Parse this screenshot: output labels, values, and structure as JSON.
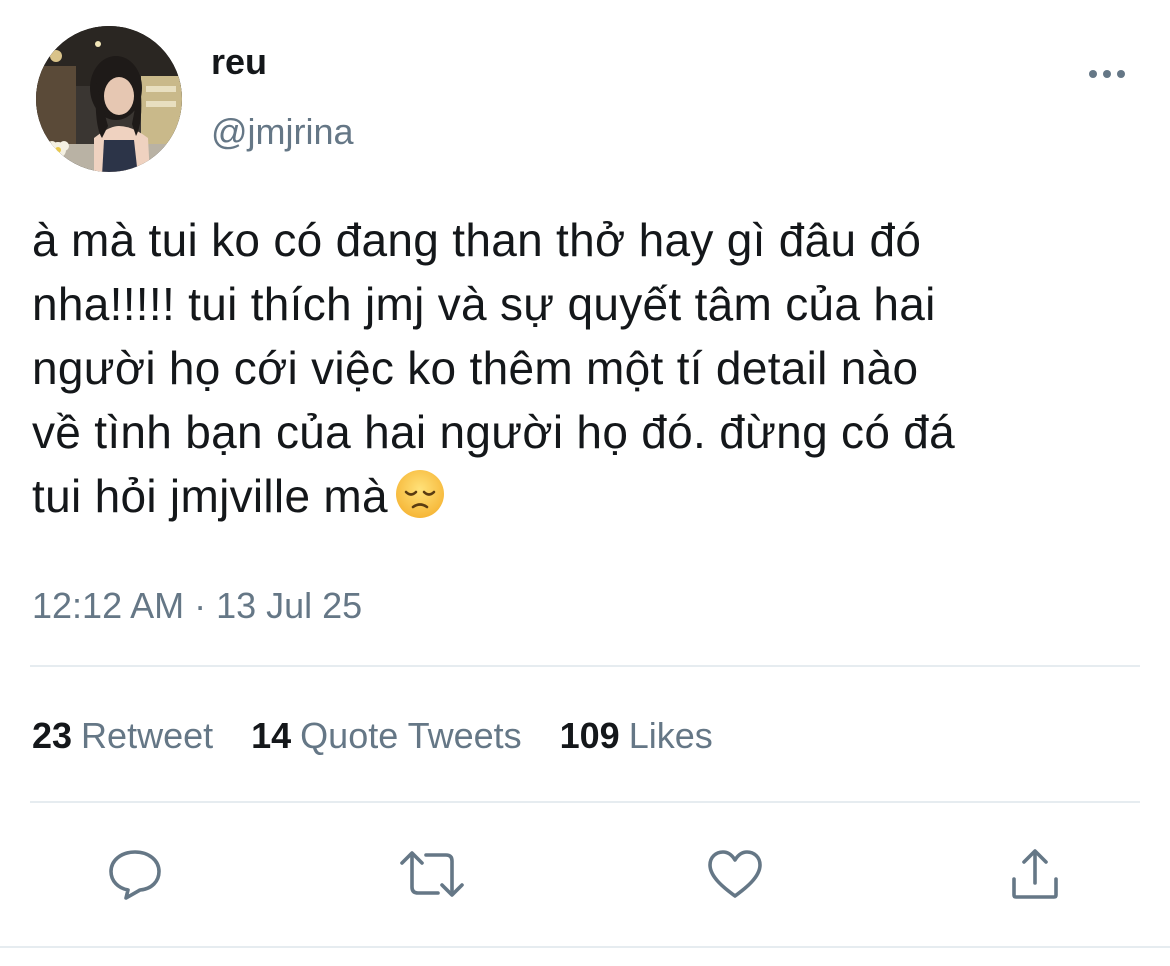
{
  "user": {
    "display_name": "reu",
    "handle": "@jmjrina"
  },
  "tweet": {
    "lines": [
      "à mà tui ko có đang than thở hay gì đâu đó",
      "nha!!!!! tui thích jmj và sự quyết tâm của hai",
      "người họ cới việc ko thêm một tí detail nào",
      "về tình bạn của hai người họ đó. đừng có đá",
      "tui hỏi jmjville mà"
    ],
    "emoji": "disappointed-face",
    "timestamp": "12:12 AM · 13 Jul 25"
  },
  "stats": {
    "retweets": {
      "count": "23",
      "label": "Retweet"
    },
    "quotes": {
      "count": "14",
      "label": "Quote Tweets"
    },
    "likes": {
      "count": "109",
      "label": "Likes"
    }
  },
  "icons": {
    "more": "more-dots-icon",
    "reply": "reply-icon",
    "retweet": "retweet-icon",
    "like": "heart-icon",
    "share": "share-icon"
  },
  "colors": {
    "text": "#14171a",
    "secondary": "#657786",
    "divider": "#e6ecf0",
    "icon": "#657786"
  }
}
